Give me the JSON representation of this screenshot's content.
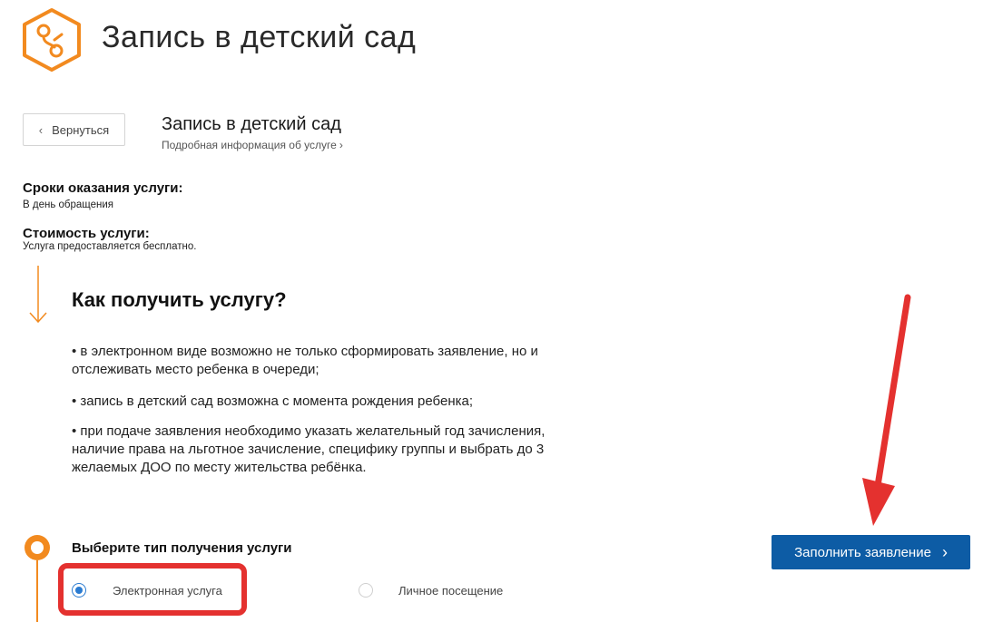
{
  "header": {
    "title": "Запись в детский сад"
  },
  "service": {
    "back_label": "Вернуться",
    "title": "Запись в детский сад",
    "info_link": "Подробная информация об услуге",
    "back_icon": "chevron-left-icon",
    "info_icon": "chevron-right-icon"
  },
  "terms": {
    "label": "Сроки оказания услуги:",
    "value": "В день обращения"
  },
  "cost": {
    "label": "Стоимость услуги:",
    "value": "Услуга предоставляется бесплатно."
  },
  "how": {
    "title": "Как получить услугу?",
    "bullets": [
      "• в электронном виде возможно не только сформировать заявление, но и отслеживать место ребенка в очереди;",
      "• запись в детский сад возможна с момента рождения ребенка;",
      "• при подаче заявления необходимо указать желательный год зачисления, наличие права на льготное зачисление, специфику группы и выбрать до 3 желаемых ДОО по месту жительства ребёнка."
    ]
  },
  "step": {
    "title": "Выберите тип получения услуги",
    "options": [
      {
        "label": "Электронная услуга",
        "selected": true
      },
      {
        "label": "Личное посещение",
        "selected": false
      }
    ]
  },
  "actions": {
    "fill_label": "Заполнить заявление"
  },
  "colors": {
    "accent": "#f28a1f",
    "primary_button": "#0d5ca5",
    "highlight": "#e4312f",
    "radio_selected": "#2a7bd1"
  }
}
